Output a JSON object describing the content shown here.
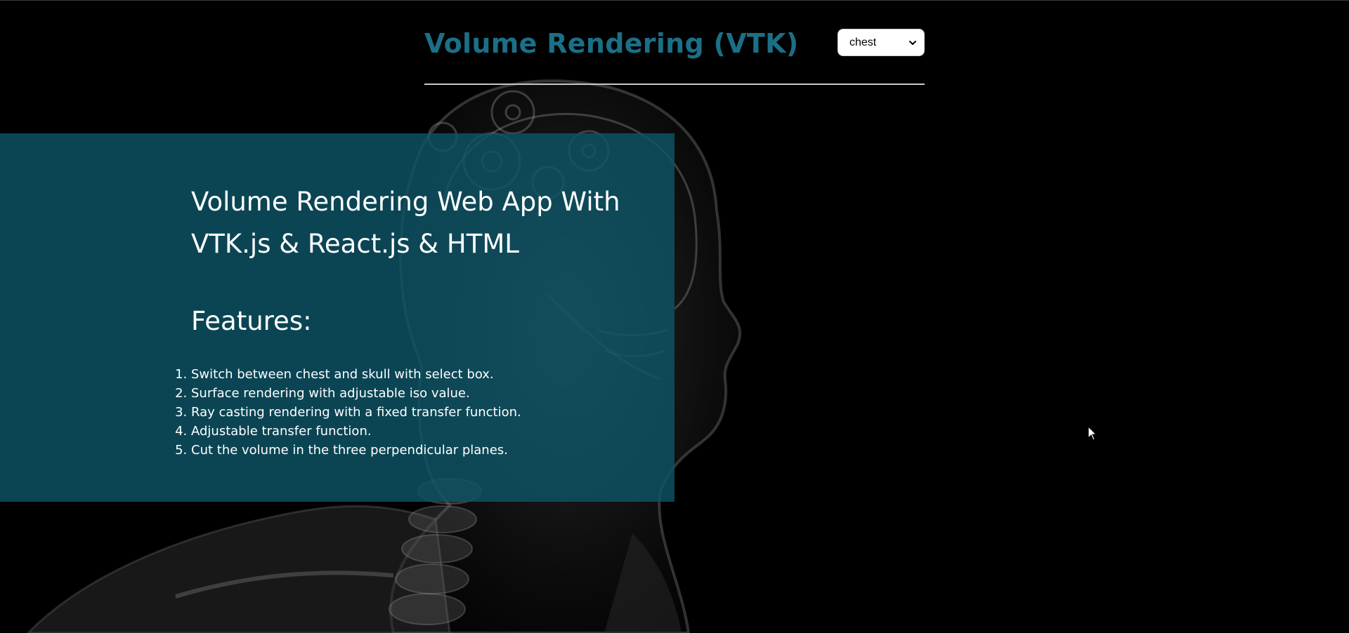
{
  "header": {
    "title": "Volume Rendering (VTK)",
    "dataset_select": {
      "selected": "chest"
    }
  },
  "panel": {
    "intro_heading": "Volume Rendering Web App With VTK.js & React.js & HTML",
    "features_heading": "Features:",
    "features": [
      "Switch between chest and skull with select box.",
      "Surface rendering with adjustable iso value.",
      "Ray casting rendering with a fixed transfer function.",
      "Adjustable transfer function.",
      "Cut the volume in the three perpendicular planes."
    ]
  },
  "colors": {
    "background": "#000000",
    "title_accent": "#1b6f87",
    "panel": "#0d5466",
    "divider": "#c8c8c8"
  },
  "icons": {
    "select_chevron": "chevron-down-icon",
    "background_art": "xray-head-gears-illustration",
    "pointer": "mouse-cursor-icon"
  }
}
